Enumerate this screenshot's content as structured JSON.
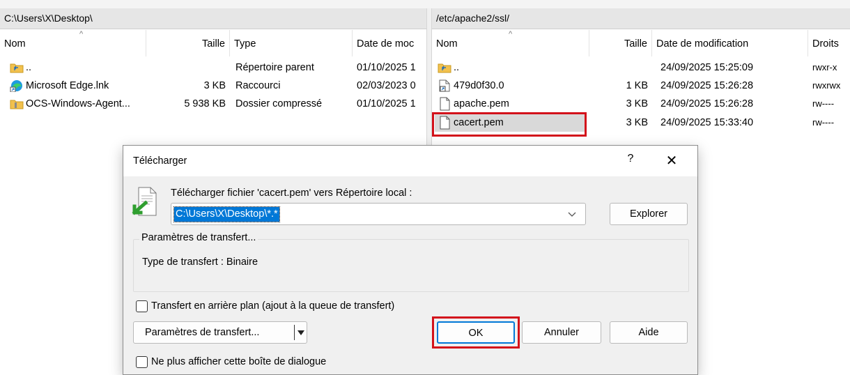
{
  "left_panel": {
    "path": "C:\\Users\\X\\Desktop\\",
    "columns": [
      "Nom",
      "Taille",
      "Type",
      "Date de moc"
    ],
    "rows": [
      {
        "icon": "parent-folder-icon",
        "name": "..",
        "size": "",
        "type": "Répertoire parent",
        "date": "01/10/2025 1"
      },
      {
        "icon": "edge-shortcut-icon",
        "name": "Microsoft Edge.lnk",
        "size": "3 KB",
        "type": "Raccourci",
        "date": "02/03/2023 0"
      },
      {
        "icon": "zip-folder-icon",
        "name": "OCS-Windows-Agent...",
        "size": "5 938 KB",
        "type": "Dossier compressé",
        "date": "01/10/2025 1"
      }
    ]
  },
  "right_panel": {
    "path": "/etc/apache2/ssl/",
    "columns": [
      "Nom",
      "Taille",
      "Date de modification",
      "Droits"
    ],
    "rows": [
      {
        "icon": "parent-folder-icon",
        "name": "..",
        "size": "",
        "date": "24/09/2025 15:25:09",
        "rights": "rwxr-x"
      },
      {
        "icon": "link-file-icon",
        "name": "479d0f30.0",
        "size": "1 KB",
        "date": "24/09/2025 15:26:28",
        "rights": "rwxrwx"
      },
      {
        "icon": "file-icon",
        "name": "apache.pem",
        "size": "3 KB",
        "date": "24/09/2025 15:26:28",
        "rights": "rw----"
      },
      {
        "icon": "file-icon",
        "name": "cacert.pem",
        "size": "3 KB",
        "date": "24/09/2025 15:33:40",
        "rights": "rw----"
      }
    ]
  },
  "dialog": {
    "title": "Télécharger",
    "help_label": "?",
    "close_label": "✕",
    "prompt": "Télécharger fichier 'cacert.pem' vers Répertoire local :",
    "target_value": "C:\\Users\\X\\Desktop\\*.*",
    "browse_label": "Explorer",
    "group_title": "Paramètres de transfert...",
    "transfer_type": "Type de transfert : Binaire",
    "background_checkbox_label": "Transfert en arrière plan (ajout à la queue de transfert)",
    "settings_button_label": "Paramètres de transfert...",
    "ok_label": "OK",
    "cancel_label": "Annuler",
    "help_button_label": "Aide",
    "dont_show_label": "Ne plus afficher cette boîte de dialogue"
  },
  "colors": {
    "highlight_red": "#d3121b",
    "selection_blue": "#0078d7"
  }
}
